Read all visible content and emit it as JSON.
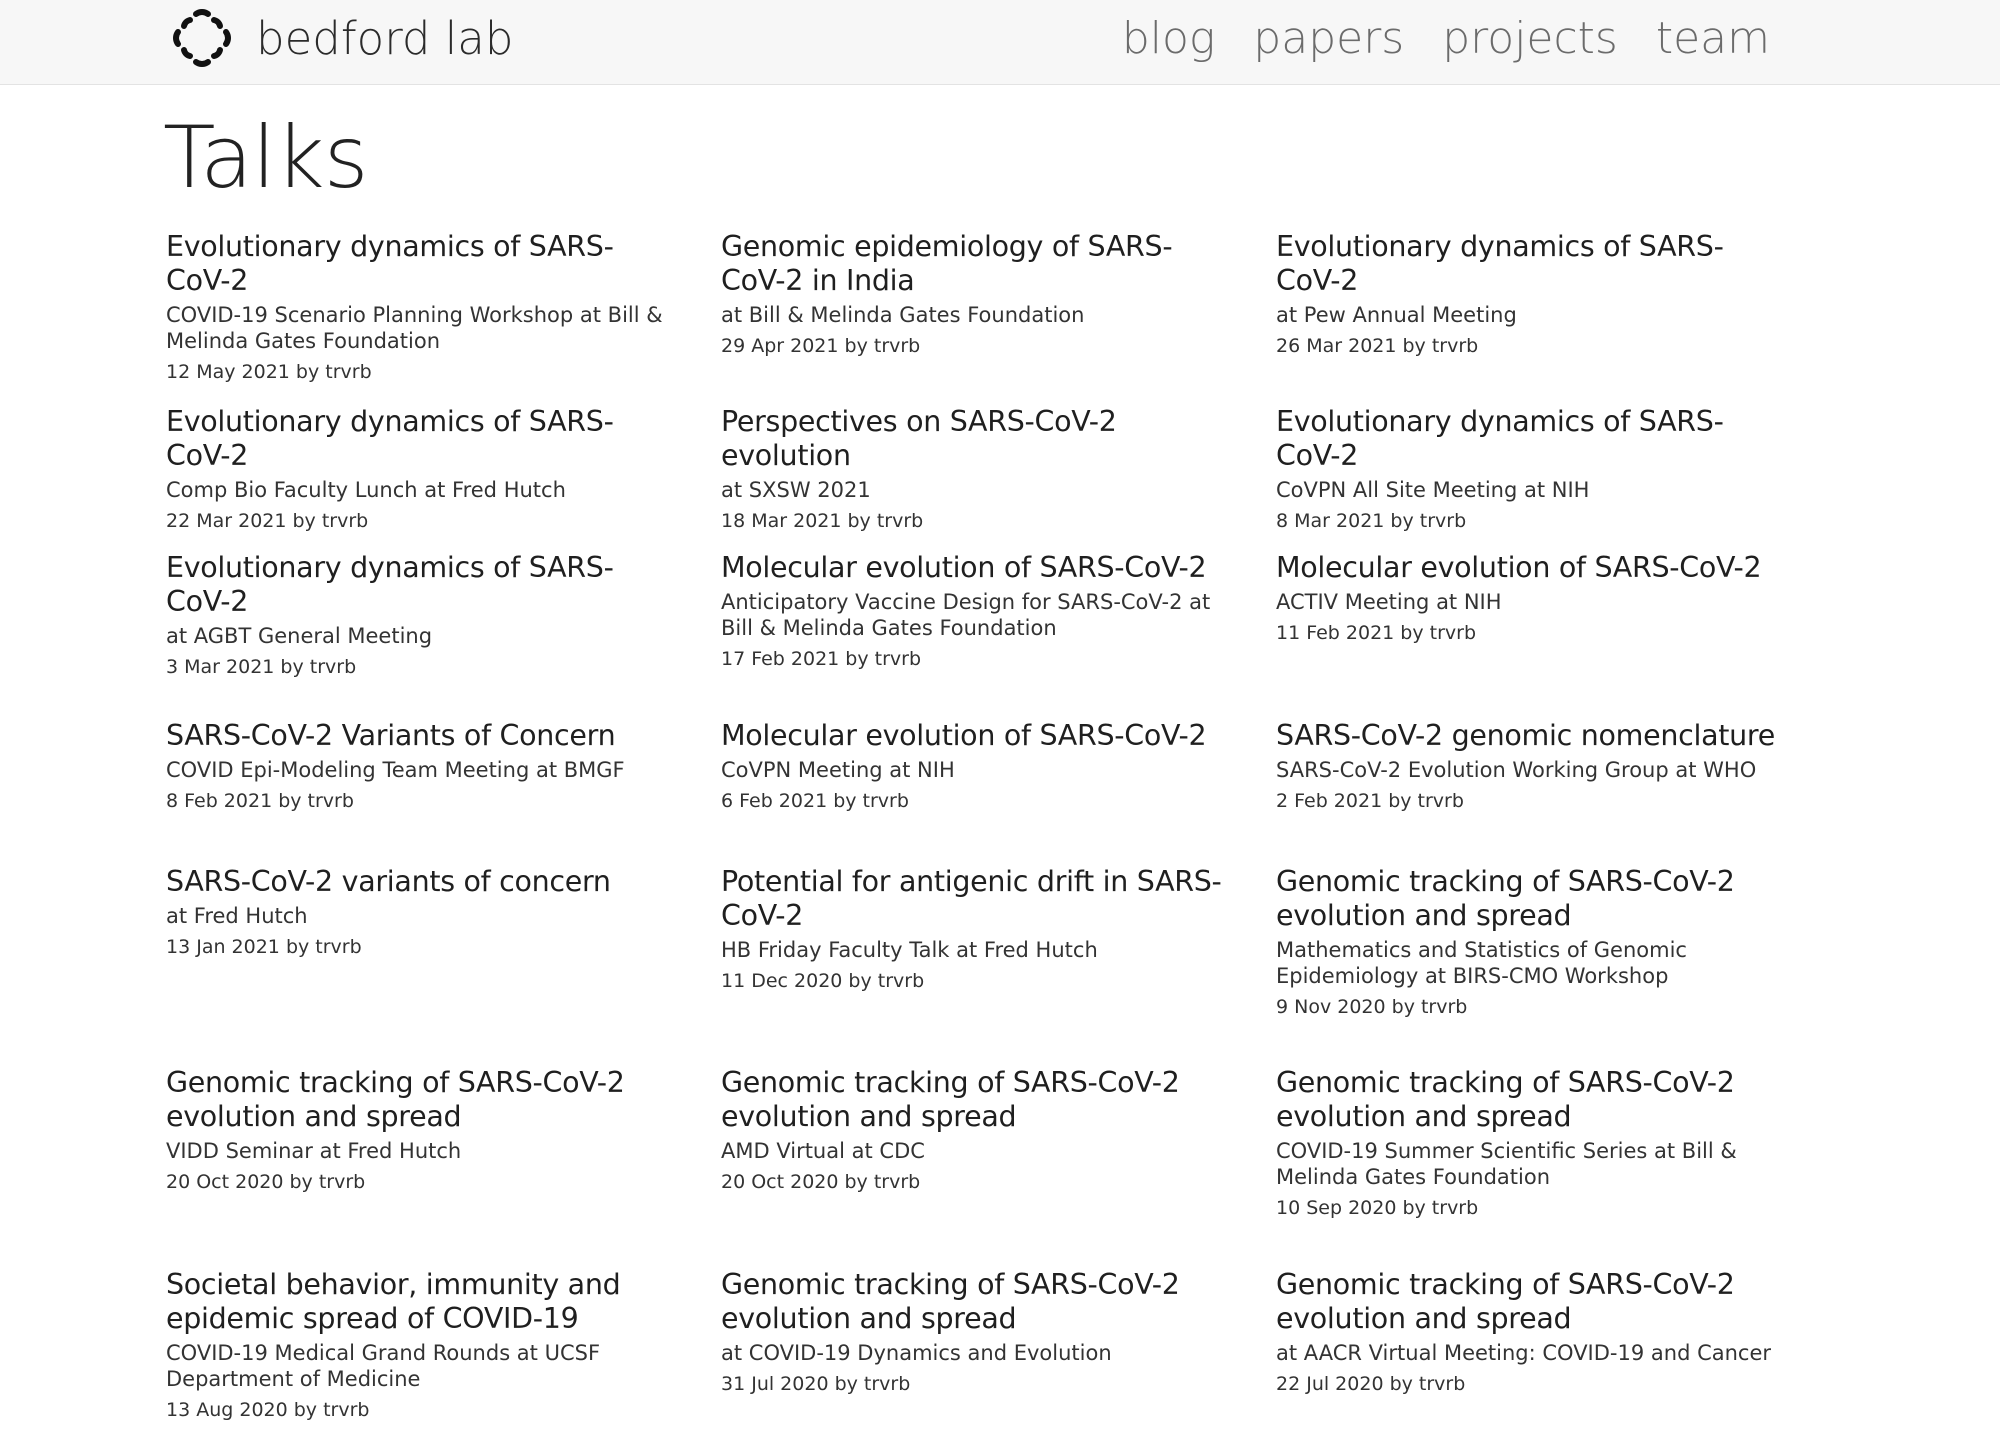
{
  "nav": {
    "brand": "bedford lab",
    "links": [
      "blog",
      "papers",
      "projects",
      "team"
    ]
  },
  "page": {
    "title": "Talks"
  },
  "talks": [
    {
      "title": "Evolutionary dynamics of SARS-CoV-2",
      "venue": "COVID-19 Scenario Planning Workshop at Bill & Melinda Gates Foundation",
      "meta": "12 May 2021 by trvrb"
    },
    {
      "title": "Genomic epidemiology of SARS-CoV-2 in India",
      "venue": "at Bill & Melinda Gates Foundation",
      "meta": "29 Apr 2021 by trvrb"
    },
    {
      "title": "Evolutionary dynamics of SARS-CoV-2",
      "venue": "at Pew Annual Meeting",
      "meta": "26 Mar 2021 by trvrb"
    },
    {
      "title": "Evolutionary dynamics of SARS-CoV-2",
      "venue": "Comp Bio Faculty Lunch at Fred Hutch",
      "meta": "22 Mar 2021 by trvrb"
    },
    {
      "title": "Perspectives on SARS-CoV-2 evolution",
      "venue": "at SXSW 2021",
      "meta": "18 Mar 2021 by trvrb"
    },
    {
      "title": "Evolutionary dynamics of SARS-CoV-2",
      "venue": "CoVPN All Site Meeting at NIH",
      "meta": "8 Mar 2021 by trvrb"
    },
    {
      "title": "Evolutionary dynamics of SARS-CoV-2",
      "venue": "at AGBT General Meeting",
      "meta": "3 Mar 2021 by trvrb"
    },
    {
      "title": "Molecular evolution of SARS-CoV-2",
      "venue": "Anticipatory Vaccine Design for SARS-CoV-2 at Bill & Melinda Gates Foundation",
      "meta": "17 Feb 2021 by trvrb"
    },
    {
      "title": "Molecular evolution of SARS-CoV-2",
      "venue": "ACTIV Meeting at NIH",
      "meta": "11 Feb 2021 by trvrb"
    },
    {
      "title": "SARS-CoV-2 Variants of Concern",
      "venue": "COVID Epi-Modeling Team Meeting at BMGF",
      "meta": "8 Feb 2021 by trvrb"
    },
    {
      "title": "Molecular evolution of SARS-CoV-2",
      "venue": "CoVPN Meeting at NIH",
      "meta": "6 Feb 2021 by trvrb"
    },
    {
      "title": "SARS-CoV-2 genomic nomenclature",
      "venue": "SARS-CoV-2 Evolution Working Group at WHO",
      "meta": "2 Feb 2021 by trvrb"
    },
    {
      "title": "SARS-CoV-2 variants of concern",
      "venue": "at Fred Hutch",
      "meta": "13 Jan 2021 by trvrb"
    },
    {
      "title": "Potential for antigenic drift in SARS-CoV-2",
      "venue": "HB Friday Faculty Talk at Fred Hutch",
      "meta": "11 Dec 2020 by trvrb"
    },
    {
      "title": "Genomic tracking of SARS-CoV-2 evolution and spread",
      "venue": "Mathematics and Statistics of Genomic Epidemiology at BIRS-CMO Workshop",
      "meta": "9 Nov 2020 by trvrb"
    },
    {
      "title": "Genomic tracking of SARS-CoV-2 evolution and spread",
      "venue": "VIDD Seminar at Fred Hutch",
      "meta": "20 Oct 2020 by trvrb"
    },
    {
      "title": "Genomic tracking of SARS-CoV-2 evolution and spread",
      "venue": "AMD Virtual at CDC",
      "meta": "20 Oct 2020 by trvrb"
    },
    {
      "title": "Genomic tracking of SARS-CoV-2 evolution and spread",
      "venue": "COVID-19 Summer Scientific Series at Bill & Melinda Gates Foundation",
      "meta": "10 Sep 2020 by trvrb"
    },
    {
      "title": "Societal behavior, immunity and epidemic spread of COVID-19",
      "venue": "COVID-19 Medical Grand Rounds at UCSF Department of Medicine",
      "meta": "13 Aug 2020 by trvrb"
    },
    {
      "title": "Genomic tracking of SARS-CoV-2 evolution and spread",
      "venue": "at COVID-19 Dynamics and Evolution",
      "meta": "31 Jul 2020 by trvrb"
    },
    {
      "title": "Genomic tracking of SARS-CoV-2 evolution and spread",
      "venue": "at AACR Virtual Meeting: COVID-19 and Cancer",
      "meta": "22 Jul 2020 by trvrb"
    }
  ]
}
